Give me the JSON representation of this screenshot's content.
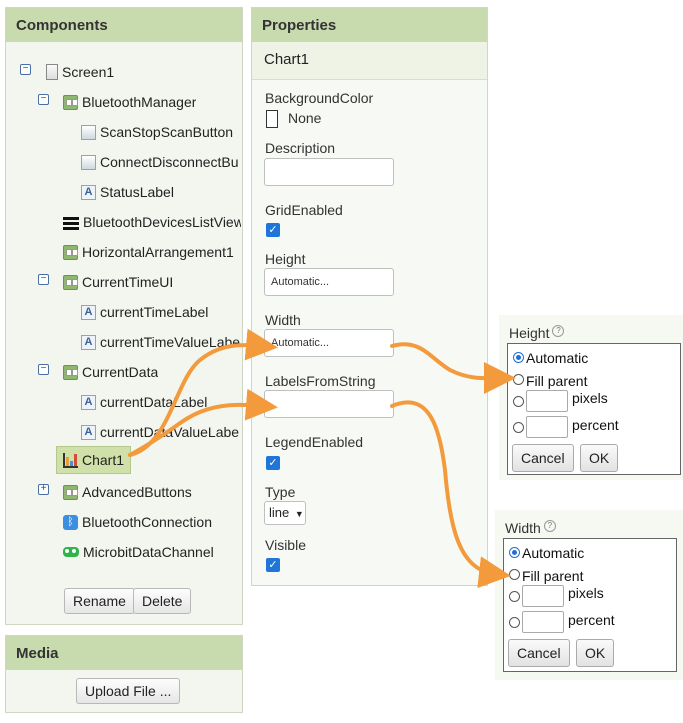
{
  "components": {
    "title": "Components",
    "tree": [
      {
        "label": "Screen1",
        "icon": "screen-icon",
        "toggle": "minus"
      },
      {
        "label": "BluetoothManager",
        "icon": "arrangement-icon",
        "toggle": "minus"
      },
      {
        "label": "ScanStopScanButton",
        "icon": "button-icon"
      },
      {
        "label": "ConnectDisconnectBu",
        "icon": "button-icon"
      },
      {
        "label": "StatusLabel",
        "icon": "label-icon"
      },
      {
        "label": "BluetoothDevicesListView",
        "icon": "listview-icon"
      },
      {
        "label": "HorizontalArrangement1",
        "icon": "arrangement-icon"
      },
      {
        "label": "CurrentTimeUI",
        "icon": "arrangement-icon",
        "toggle": "minus"
      },
      {
        "label": "currentTimeLabel",
        "icon": "label-icon"
      },
      {
        "label": "currentTimeValueLabe",
        "icon": "label-icon"
      },
      {
        "label": "CurrentData",
        "icon": "arrangement-icon",
        "toggle": "minus"
      },
      {
        "label": "currentDataLabel",
        "icon": "label-icon"
      },
      {
        "label": "currentDataValueLabe",
        "icon": "label-icon"
      },
      {
        "label": "Chart1",
        "icon": "chart-icon",
        "selected": true
      },
      {
        "label": "AdvancedButtons",
        "icon": "arrangement-icon",
        "toggle": "plus"
      },
      {
        "label": "BluetoothConnection",
        "icon": "bluetooth-icon"
      },
      {
        "label": "MicrobitDataChannel",
        "icon": "microbit-icon"
      }
    ],
    "rename_label": "Rename",
    "delete_label": "Delete"
  },
  "media": {
    "title": "Media",
    "upload_label": "Upload File ..."
  },
  "properties": {
    "title": "Properties",
    "component": "Chart1",
    "background_color_label": "BackgroundColor",
    "background_color_value": "None",
    "description_label": "Description",
    "description_value": "",
    "grid_enabled_label": "GridEnabled",
    "grid_enabled": true,
    "height_label": "Height",
    "height_value": "Automatic...",
    "width_label": "Width",
    "width_value": "Automatic...",
    "labels_from_string_label": "LabelsFromString",
    "labels_from_string_value": "",
    "legend_enabled_label": "LegendEnabled",
    "legend_enabled": true,
    "type_label": "Type",
    "type_value": "line",
    "visible_label": "Visible",
    "visible": true
  },
  "height_popup": {
    "title": "Height",
    "help": "?",
    "automatic_label": "Automatic",
    "fill_parent_label": "Fill parent",
    "pixels_label": "pixels",
    "percent_label": "percent",
    "cancel_label": "Cancel",
    "ok_label": "OK"
  },
  "width_popup": {
    "title": "Width",
    "help": "?",
    "automatic_label": "Automatic",
    "fill_parent_label": "Fill parent",
    "pixels_label": "pixels",
    "percent_label": "percent",
    "cancel_label": "Cancel",
    "ok_label": "OK"
  },
  "colors": {
    "panel_header": "#c7dbae",
    "selected_row": "#cfe0a8",
    "checkbox": "#1f75d8",
    "arrow": "#f39a3c"
  }
}
